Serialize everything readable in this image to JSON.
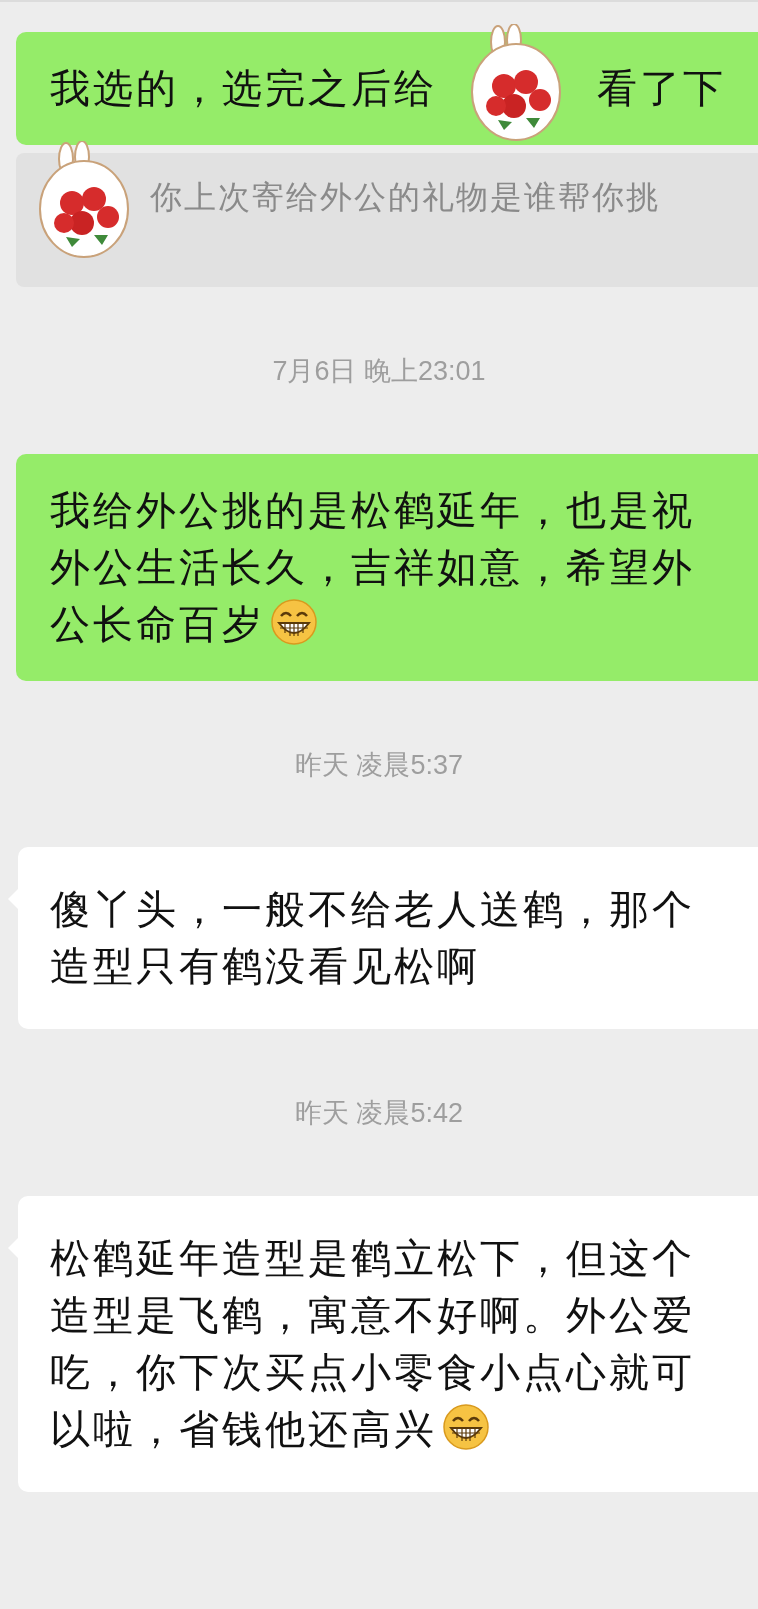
{
  "messages": [
    {
      "kind": "outgoing",
      "segments": [
        "我选的，选完之后给",
        "看了下"
      ],
      "covered": true
    },
    {
      "kind": "quote",
      "segments": [
        "你上次寄给外公的礼物是谁帮你挑"
      ],
      "covered": true
    },
    {
      "kind": "time",
      "segments": [
        "7月6日 晚上23:01"
      ]
    },
    {
      "kind": "outgoing",
      "segments": [
        "我给外公挑的是松鹤延年，也是祝外公生活长久，吉祥如意，希望外公长命百岁"
      ],
      "grin_emoji": true
    },
    {
      "kind": "time",
      "segments": [
        "昨天 凌晨5:37"
      ]
    },
    {
      "kind": "incoming",
      "segments": [
        "傻丫头，一般不给老人送鹤，那个造型只有鹤没看见松啊"
      ]
    },
    {
      "kind": "time",
      "segments": [
        "昨天 凌晨5:42"
      ]
    },
    {
      "kind": "incoming",
      "segments": [
        "松鹤延年造型是鹤立松下，但这个造型是飞鹤，寓意不好啊。外公爱吃，你下次买点小零食小点心就可以啦，省钱他还高兴"
      ],
      "grin_emoji": true
    }
  ]
}
